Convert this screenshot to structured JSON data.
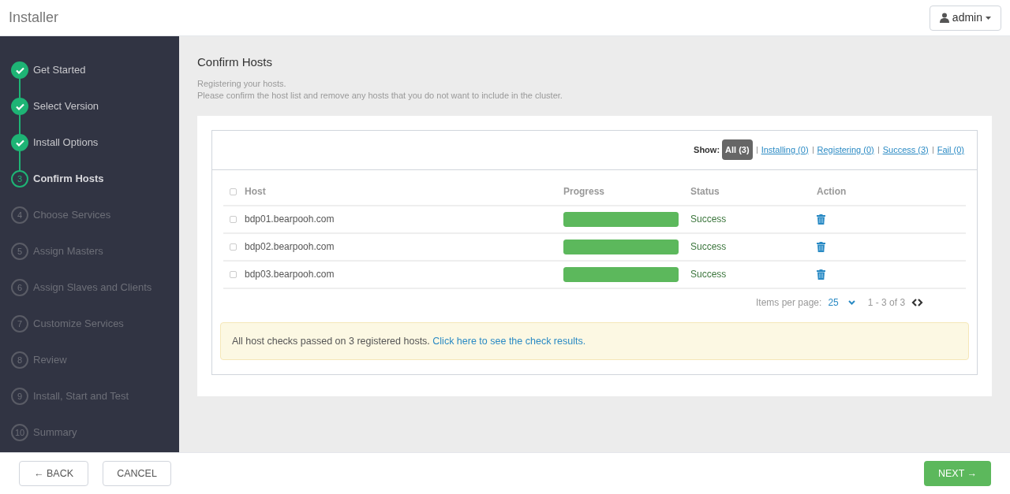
{
  "app_title": "Installer",
  "user_menu": {
    "label": "admin"
  },
  "steps": [
    {
      "label": "Get Started",
      "kind": "done"
    },
    {
      "label": "Select Version",
      "kind": "done"
    },
    {
      "label": "Install Options",
      "kind": "done"
    },
    {
      "number": "3",
      "label": "Confirm Hosts",
      "kind": "current"
    },
    {
      "number": "4",
      "label": "Choose Services",
      "kind": "todo"
    },
    {
      "number": "5",
      "label": "Assign Masters",
      "kind": "todo"
    },
    {
      "number": "6",
      "label": "Assign Slaves and Clients",
      "kind": "todo"
    },
    {
      "number": "7",
      "label": "Customize Services",
      "kind": "todo"
    },
    {
      "number": "8",
      "label": "Review",
      "kind": "todo"
    },
    {
      "number": "9",
      "label": "Install, Start and Test",
      "kind": "todo"
    },
    {
      "number": "10",
      "label": "Summary",
      "kind": "todo"
    }
  ],
  "page": {
    "title": "Confirm Hosts",
    "subtitle_lines": [
      "Registering your hosts.",
      "Please confirm the host list and remove any hosts that you do not want to include in the cluster."
    ]
  },
  "filter": {
    "label": "Show:",
    "options": [
      {
        "label": "All (3)",
        "selected": true
      },
      {
        "label": "Installing (0)",
        "selected": false
      },
      {
        "label": "Registering (0)",
        "selected": false
      },
      {
        "label": "Success (3)",
        "selected": false
      },
      {
        "label": "Fail (0)",
        "selected": false
      }
    ]
  },
  "table": {
    "select_all_checked": false,
    "columns": [
      "Host",
      "Progress",
      "Status",
      "Action"
    ],
    "rows": [
      {
        "checked": false,
        "host": "bdp01.bearpooh.com",
        "level": 1,
        "status": "Success"
      },
      {
        "checked": false,
        "host": "bdp02.bearpooh.com",
        "level": 1,
        "status": "Success"
      },
      {
        "checked": false,
        "host": "bdp03.bearpooh.com",
        "level": 1,
        "status": "Success"
      }
    ]
  },
  "pagination": {
    "label": "Items per page:",
    "per_page": "25",
    "range": "1 - 3 of 3"
  },
  "alert": {
    "text": "All host checks passed on 3 registered hosts.",
    "link": "Click here to see the check results."
  },
  "footer": {
    "back": "← BACK",
    "cancel": "CANCEL",
    "next": "NEXT →"
  }
}
